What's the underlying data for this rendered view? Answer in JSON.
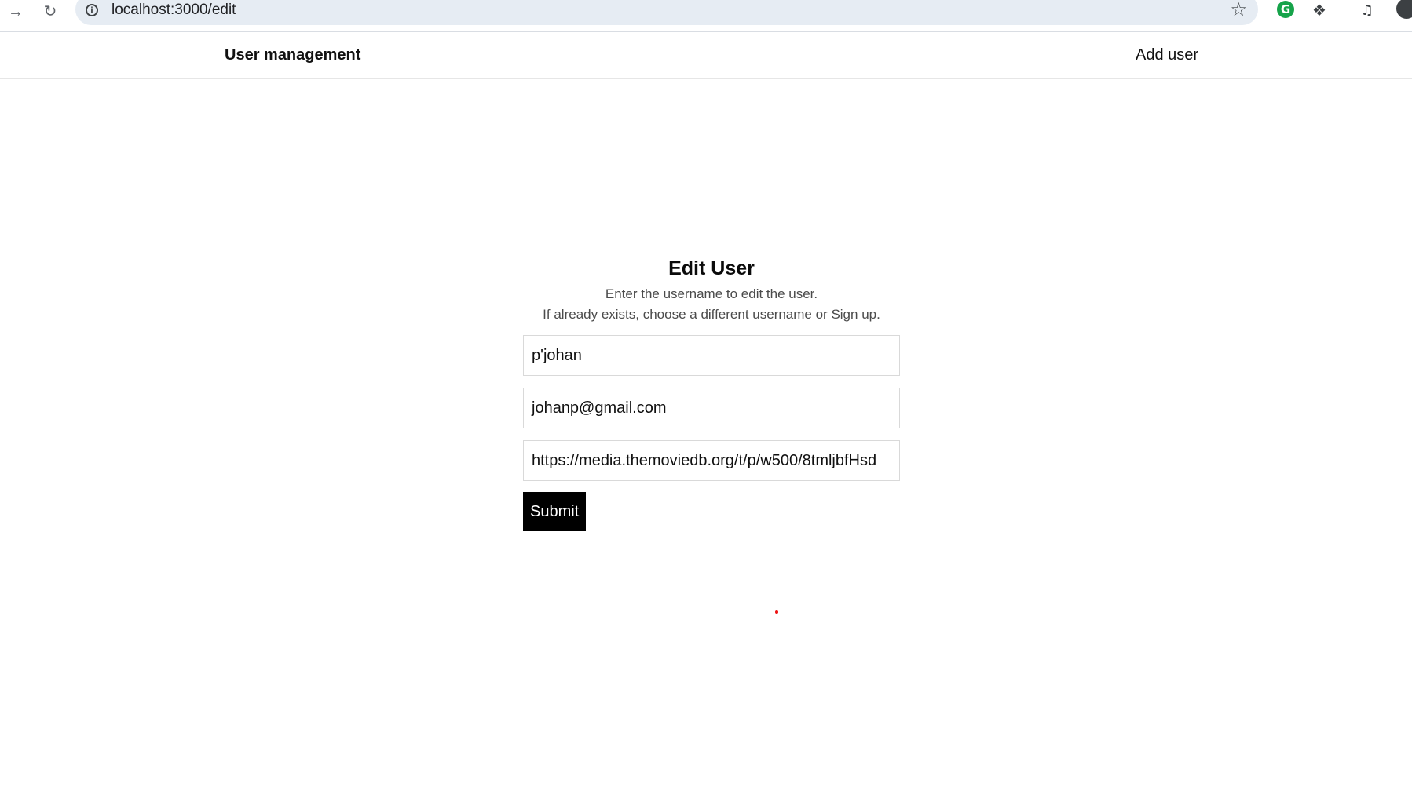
{
  "browser": {
    "forward_icon": "arrow-right-icon",
    "reload_icon": "reload-icon",
    "url": "localhost:3000/edit",
    "info_icon": "info-icon",
    "bookmark_icon": "star-icon",
    "extensions": [
      "grammarly-icon",
      "puzzle-icon",
      "media-control-icon",
      "profile-avatar"
    ]
  },
  "header": {
    "brand": "User management",
    "add_user_link": "Add user"
  },
  "form": {
    "title": "Edit User",
    "subtitle_line1": "Enter the username to edit the user.",
    "subtitle_line2": "If already exists, choose a different username or Sign up.",
    "username_value": "p'johan",
    "email_value": "johanp@gmail.com",
    "image_url_value": "https://media.themoviedb.org/t/p/w500/8tmljbfHsd",
    "submit_label": "Submit"
  },
  "colors": {
    "addressbar_bg": "#e6ecf3",
    "button_bg": "#000000",
    "grammarly": "#16a34a"
  }
}
